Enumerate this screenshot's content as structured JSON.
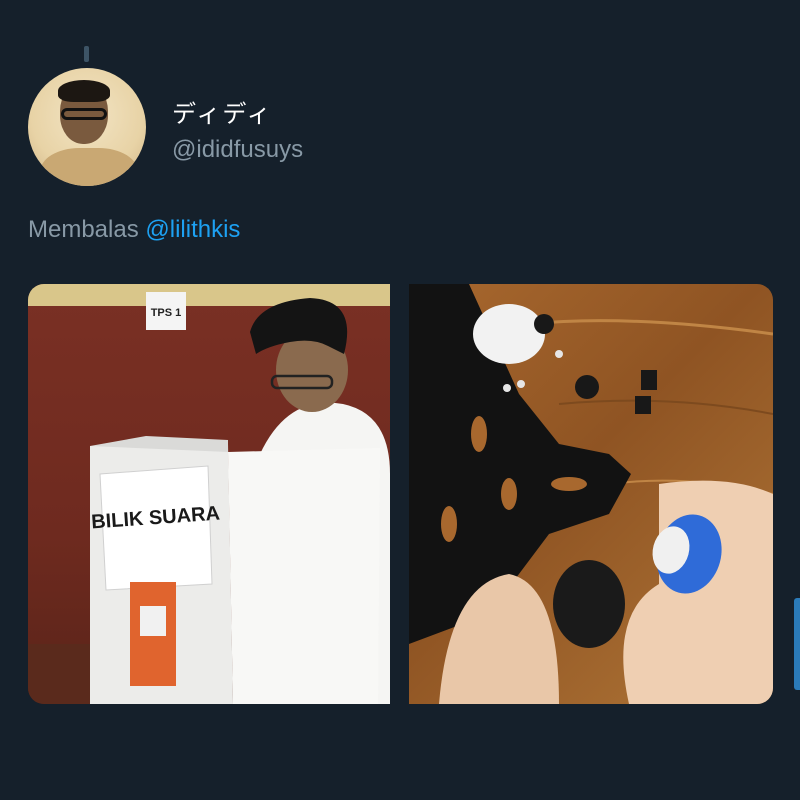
{
  "tweet": {
    "display_name": "ディディ",
    "handle": "@ididfusuys",
    "reply_prefix": "Membalas",
    "reply_mention": "@lilithkis"
  },
  "media": {
    "left": {
      "sign_tps": "TPS 1",
      "booth_label": "BILIK SUARA"
    },
    "right": {}
  },
  "colors": {
    "background": "#15202b",
    "text_primary": "#ffffff",
    "text_secondary": "#8899a6",
    "mention": "#1da1f2"
  }
}
